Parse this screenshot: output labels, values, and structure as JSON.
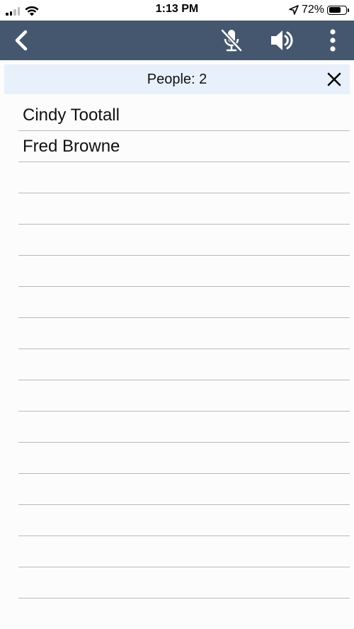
{
  "status_bar": {
    "time": "1:13 PM",
    "battery_percent": "72%",
    "battery_level": 0.72,
    "signal_bars": 2,
    "icons": [
      "signal-icon",
      "wifi-icon",
      "location-arrow-icon",
      "battery-icon"
    ]
  },
  "toolbar": {
    "icons": [
      "back-chevron-icon",
      "mic-muted-icon",
      "speaker-icon",
      "more-vertical-icon"
    ],
    "background": "#44576f"
  },
  "people_bar": {
    "label": "People: 2",
    "close_icon": "close-icon",
    "background": "#e8f0fb"
  },
  "people": [
    {
      "name": "Cindy Tootall"
    },
    {
      "name": "Fred Browne"
    },
    {
      "name": ""
    },
    {
      "name": ""
    },
    {
      "name": ""
    },
    {
      "name": ""
    },
    {
      "name": ""
    },
    {
      "name": ""
    },
    {
      "name": ""
    },
    {
      "name": ""
    },
    {
      "name": ""
    },
    {
      "name": ""
    },
    {
      "name": ""
    },
    {
      "name": ""
    },
    {
      "name": ""
    },
    {
      "name": ""
    }
  ]
}
